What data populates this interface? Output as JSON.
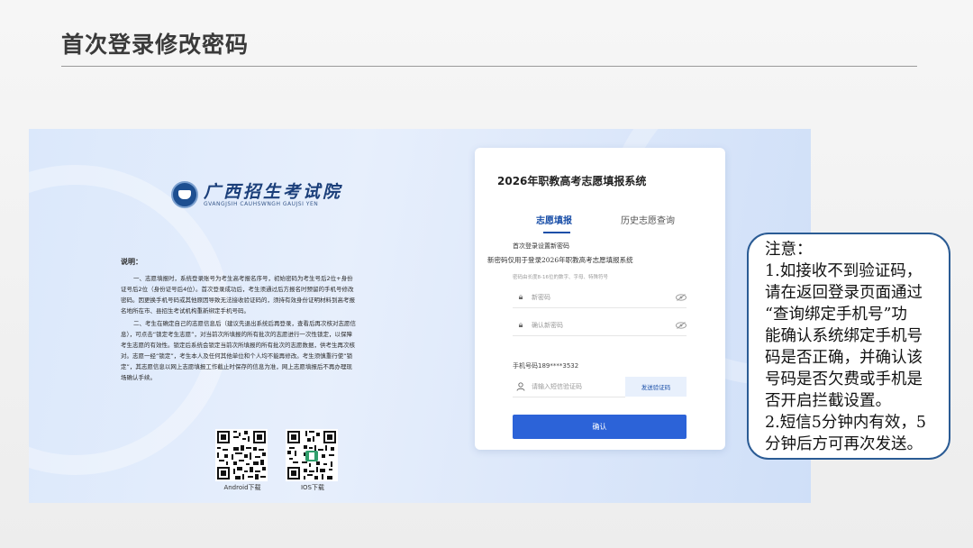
{
  "slide": {
    "title": "首次登录修改密码"
  },
  "site": {
    "logo_cn": "广西招生考试院",
    "logo_en": "GVANGJSIH CAUHSWNGH GAUJSI YEN"
  },
  "instructions": {
    "title": "说明：",
    "para1": "一、志愿填报时，系统登录账号为考生高考报名序号，初始密码为考生号后2位+身份证号后2位（身份证号后4位）。首次登录成功后，考生须通过后方报名时预留的手机号修改密码。因更换手机号码或其他原因导致无法接收验证码的，须持有效身份证明材料到高考报名地所在市、县招生考试机构重新绑定手机号码。",
    "para2": "二、考生在确定自己的志愿信息后（建议先退出系统后再登录，查看后再次核对志愿信息），可点击“锁定考生志愿”，对当前次所填报的所有批次的志愿进行一次性锁定，以保障考生志愿的有效性。锁定后系统会锁定当前次所填报的所有批次的志愿数据，供考生再次核对。志愿一经“锁定”，考生本人及任何其他单位和个人均不能再修改。考生须慎重行使“锁定”，其志愿信息以网上志愿填报工作截止时保存的信息为准，网上志愿填报后不再办理现场确认手续。"
  },
  "qr_codes": [
    {
      "label": "Android下载"
    },
    {
      "label": "IOS下载"
    }
  ],
  "login": {
    "system_title": "2026年职教高考志愿填报系统",
    "tabs": [
      {
        "label": "志愿填报",
        "active": true
      },
      {
        "label": "历史志愿查询",
        "active": false
      }
    ],
    "form_heading": "首次登录设置新密码",
    "form_subtitle": "新密码仅用于登录2026年职教高考志愿填报系统",
    "password_hint": "密码由长度8-16位的数字、字母、特殊符号",
    "new_password_placeholder": "新密码",
    "confirm_password_placeholder": "确认新密码",
    "phone_label": "手机号码",
    "phone_value": "189****3532",
    "sms_placeholder": "请输入短信验证码",
    "send_code_label": "发送验证码",
    "confirm_label": "确认"
  },
  "note": {
    "lines": [
      "注意：",
      "1.如接收不到验证码，",
      "请在返回登录页面通过",
      "“查询绑定手机号”功",
      "能确认系统绑定手机号",
      "码是否正确，并确认该",
      "号码是否欠费或手机是",
      "否开启拦截设置。",
      "2.短信5分钟内有效，5",
      "分钟后方可再次发送。"
    ]
  },
  "colors": {
    "accent": "#2c63d8",
    "tab_active": "#1a4fa8",
    "note_border": "#2a5b94"
  }
}
